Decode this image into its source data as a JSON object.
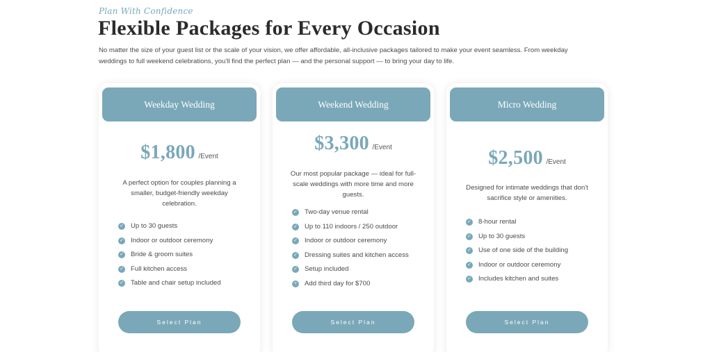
{
  "header": {
    "tagline": "Plan With Confidence",
    "title": "Flexible Packages for Every Occasion",
    "intro": "No matter the size of your guest list or the scale of your vision, we offer affordable, all-inclusive packages tailored to make your event seamless. From weekday weddings to full weekend celebrations, you'll find the perfect plan — and the personal support — to bring your day to life."
  },
  "colors": {
    "accent": "#7aa8b8",
    "text": "#4a4a4a",
    "heading": "#2b2b2b"
  },
  "plans": [
    {
      "name": "Weekday Wedding",
      "price": "$1,800",
      "unit": "/Event",
      "description": "A perfect option for couples planning a smaller, budget-friendly weekday celebration.",
      "features": [
        {
          "icon": "check-circle-icon",
          "text": "Up to 30 guests"
        },
        {
          "icon": "check-circle-icon",
          "text": "Indoor or outdoor ceremony"
        },
        {
          "icon": "check-circle-icon",
          "text": "Bride & groom suites"
        },
        {
          "icon": "check-circle-icon",
          "text": "Full kitchen access"
        },
        {
          "icon": "check-circle-icon",
          "text": "Table and chair setup included"
        }
      ],
      "button": "Select Plan"
    },
    {
      "name": "Weekend Wedding",
      "price": "$3,300",
      "unit": "/Event",
      "description": "Our most popular package — ideal for full-scale weddings with more time and more guests.",
      "features": [
        {
          "icon": "check-circle-icon",
          "text": "Two-day venue rental"
        },
        {
          "icon": "check-circle-icon",
          "text": "Up to 110 indoors / 250 outdoor"
        },
        {
          "icon": "check-circle-icon",
          "text": "Indoor or outdoor ceremony"
        },
        {
          "icon": "check-circle-icon",
          "text": "Dressing suites and kitchen access"
        },
        {
          "icon": "check-circle-icon",
          "text": "Setup included"
        },
        {
          "icon": "plus-circle-icon",
          "text": "Add third day for $700"
        }
      ],
      "button": "Select Plan"
    },
    {
      "name": "Micro Wedding",
      "price": "$2,500",
      "unit": "/Event",
      "description": "Designed for intimate weddings that don't sacrifice style or amenities.",
      "features": [
        {
          "icon": "check-circle-icon",
          "text": "8-hour rental"
        },
        {
          "icon": "check-circle-icon",
          "text": "Up to 30 guests"
        },
        {
          "icon": "check-circle-icon",
          "text": "Use of one side of the building"
        },
        {
          "icon": "check-circle-icon",
          "text": "Indoor or outdoor ceremony"
        },
        {
          "icon": "check-circle-icon",
          "text": "Includes kitchen and suites"
        }
      ],
      "button": "Select Plan"
    }
  ]
}
